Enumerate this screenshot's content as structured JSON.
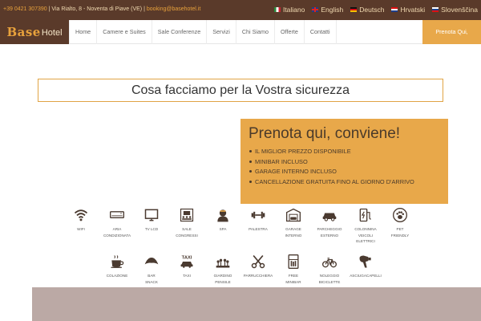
{
  "topbar": {
    "phone": "+39 0421 307390",
    "address": "Via Rialto, 8 - Noventa di Piave (VE)",
    "email": "booking@basehotel.it",
    "languages": [
      {
        "label": "Italiano",
        "flag": "flag-it"
      },
      {
        "label": "English",
        "flag": "flag-en"
      },
      {
        "label": "Deutsch",
        "flag": "flag-de"
      },
      {
        "label": "Hrvatski",
        "flag": "flag-hr"
      },
      {
        "label": "Slovenščina",
        "flag": "flag-sl"
      }
    ]
  },
  "logo": {
    "brand": "Base",
    "suffix": "Hotel"
  },
  "nav": {
    "items": [
      "Home",
      "Camere e Suites",
      "Sale Conferenze",
      "Servizi",
      "Chi Siamo",
      "Offerte",
      "Contatti"
    ],
    "cta": "Prenota Qui, Conviene!"
  },
  "main": {
    "section_title": "Cosa facciamo per la Vostra sicurezza"
  },
  "booking": {
    "title": "Prenota qui, conviene!",
    "bullets": [
      "IL MIGLIOR PREZZO DISPONIBILE",
      "MINIBAR INCLUSO",
      "GARAGE INTERNO INCLUSO",
      "CANCELLAZIONE GRATUITA FINO AL GIORNO D'ARRIVO"
    ]
  },
  "amenities": {
    "row1": [
      {
        "icon": "wifi-icon",
        "label": [
          "WIFI"
        ]
      },
      {
        "icon": "air-conditioner-icon",
        "label": [
          "ARIA",
          "CONDIZIONATA"
        ]
      },
      {
        "icon": "tv-icon",
        "label": [
          "TV LCD"
        ]
      },
      {
        "icon": "conference-room-icon",
        "label": [
          "SALE",
          "CONGRESSI"
        ]
      },
      {
        "icon": "spa-icon",
        "label": [
          "SPA"
        ]
      },
      {
        "icon": "dumbbell-icon",
        "label": [
          "PALESTRA"
        ]
      },
      {
        "icon": "garage-icon",
        "label": [
          "GARAGE",
          "INTERNO"
        ]
      },
      {
        "icon": "car-icon",
        "label": [
          "PARCHEGGIO",
          "ESTERNO"
        ]
      },
      {
        "icon": "ev-charger-icon",
        "label": [
          "COLONNINA",
          "VEICOLI",
          "ELETTRICI"
        ]
      },
      {
        "icon": "paw-icon",
        "label": [
          "PET",
          "FRIENDLY"
        ]
      }
    ],
    "row2": [
      {
        "icon": "coffee-cup-icon",
        "label": [
          "COLAZIONE"
        ]
      },
      {
        "icon": "croissant-icon",
        "label": [
          "BAR",
          "SNACK"
        ]
      },
      {
        "icon": "taxi-icon",
        "label": [
          "TAXI"
        ]
      },
      {
        "icon": "garden-icon",
        "label": [
          "GIARDINO",
          "PENSILE"
        ]
      },
      {
        "icon": "scissors-icon",
        "label": [
          "PARRUCCHIERA"
        ]
      },
      {
        "icon": "minibar-icon",
        "label": [
          "FREE",
          "MINIBAR"
        ]
      },
      {
        "icon": "bicycle-icon",
        "label": [
          "NOLEGGIO",
          "BICICLETTE"
        ]
      },
      {
        "icon": "hairdryer-icon",
        "label": [
          "ASCIUGACAPELLI"
        ]
      }
    ]
  },
  "colors": {
    "brown": "#5a3a2a",
    "accent": "#e8a84a",
    "band": "#bba9a5"
  }
}
